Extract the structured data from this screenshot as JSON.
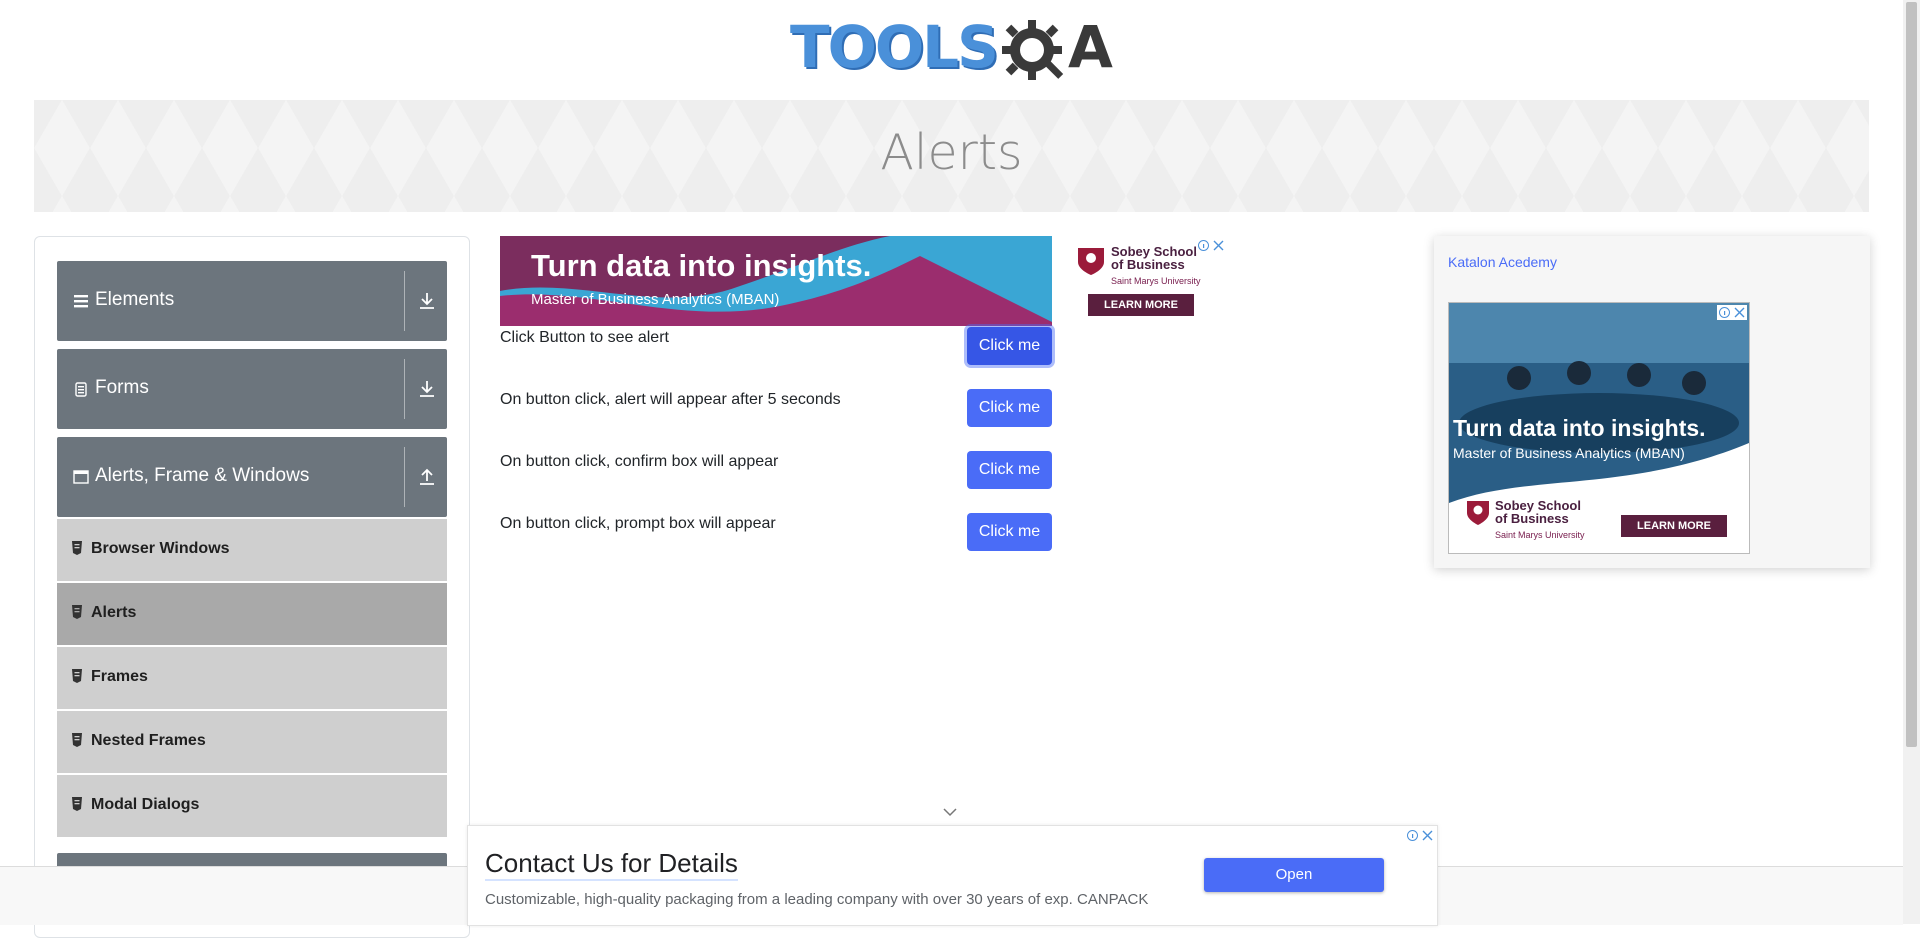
{
  "header": {
    "logo_main": "TOOLS",
    "logo_tail": "A",
    "logo_alt": "TOOLSQA"
  },
  "banner": {
    "title": "Alerts"
  },
  "sidebar": {
    "groups": [
      {
        "label": "Elements",
        "icon": "list-icon",
        "arrow": "download-icon"
      },
      {
        "label": "Forms",
        "icon": "form-icon",
        "arrow": "download-icon"
      },
      {
        "label": "Alerts, Frame & Windows",
        "icon": "window-icon",
        "arrow": "upload-icon"
      }
    ],
    "items": [
      {
        "label": "Browser Windows"
      },
      {
        "label": "Alerts"
      },
      {
        "label": "Frames"
      },
      {
        "label": "Nested Frames"
      },
      {
        "label": "Modal Dialogs"
      }
    ],
    "active_item": "Alerts"
  },
  "main": {
    "rows": [
      {
        "text": "Click Button to see alert",
        "button": "Click me"
      },
      {
        "text": "On button click, alert will appear after 5 seconds",
        "button": "Click me"
      },
      {
        "text": "On button click, confirm box will appear",
        "button": "Click me"
      },
      {
        "text": "On button click, prompt box will appear",
        "button": "Click me"
      }
    ]
  },
  "ad_top": {
    "headline": "Turn data into insights.",
    "subline": "Master of Business Analytics (MBAN)",
    "school_line1": "Sobey School",
    "school_line2": "of Business",
    "university": "Saint Marys University",
    "cta": "LEARN MORE"
  },
  "right_ad": {
    "image_alt": "Katalon Acedemy",
    "headline": "Turn data into insights.",
    "subline": "Master of Business Analytics (MBAN)",
    "school_line1": "Sobey School",
    "school_line2": "of Business",
    "university": "Saint Marys University",
    "cta": "LEARN MORE"
  },
  "bottom_ad": {
    "title": "Contact Us for Details",
    "description": "Customizable, high-quality packaging from a leading company with over 30 years of exp. CANPACK",
    "button": "Open"
  },
  "colors": {
    "primary_button": "#4a6cf7",
    "sidebar_group_bg": "#6c757d",
    "sidebar_item_bg": "#cfcfcf",
    "sidebar_active_bg": "#a9a9a9",
    "logo_blue": "#4a90d9"
  }
}
